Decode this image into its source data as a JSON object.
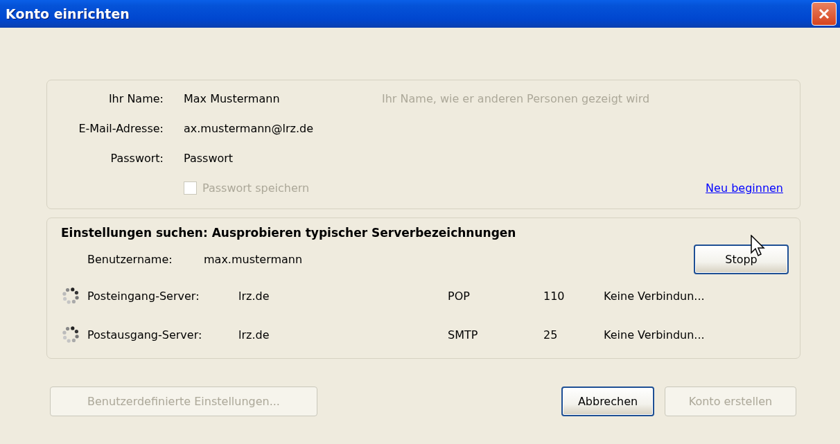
{
  "window": {
    "title": "Konto einrichten"
  },
  "account": {
    "fields": [
      {
        "label": "Ihr Name:",
        "value": "Max Mustermann",
        "hint": "Ihr Name, wie er anderen Personen gezeigt wird"
      },
      {
        "label": "E-Mail-Adresse:",
        "value": "ax.mustermann@lrz.de"
      },
      {
        "label": "Passwort:",
        "value": "Passwort"
      }
    ],
    "save_password": {
      "label": "Passwort speichern",
      "checked": false,
      "disabled": true
    },
    "restart_link": "Neu beginnen"
  },
  "search": {
    "heading": "Einstellungen suchen: Ausprobieren typischer Serverbezeichnungen",
    "username": {
      "label": "Benutzername:",
      "value": "max.mustermann"
    },
    "stop_button": {
      "label": "Stopp",
      "disabled": false
    },
    "servers": [
      {
        "label": "Posteingang-Server:",
        "host": "lrz.de",
        "protocol": "POP",
        "port": "110",
        "status": "Keine Verbindun...",
        "busy": true
      },
      {
        "label": "Postausgang-Server:",
        "host": "lrz.de",
        "protocol": "SMTP",
        "port": "25",
        "status": "Keine Verbindun...",
        "busy": true
      }
    ]
  },
  "buttons": [
    {
      "label": "Benutzerdefinierte Einstellungen...",
      "disabled": true
    },
    {
      "label": "Abbrechen",
      "disabled": false
    },
    {
      "label": "Konto erstellen",
      "disabled": true
    }
  ]
}
